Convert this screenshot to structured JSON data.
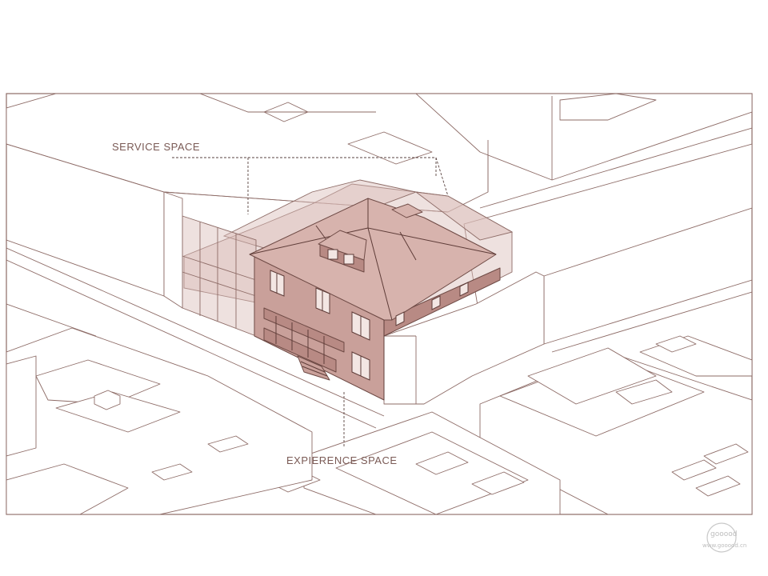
{
  "labels": {
    "service_space": "SERVICE SPACE",
    "experience_space": "EXPIERENCE SPACE"
  },
  "watermark": {
    "logo_text": "gooood",
    "url_text": "www.gooood.cn"
  },
  "colors": {
    "line": "#8d6b66",
    "house_fill": "#c9a09a",
    "glass_fill": "#d9bdb7"
  }
}
